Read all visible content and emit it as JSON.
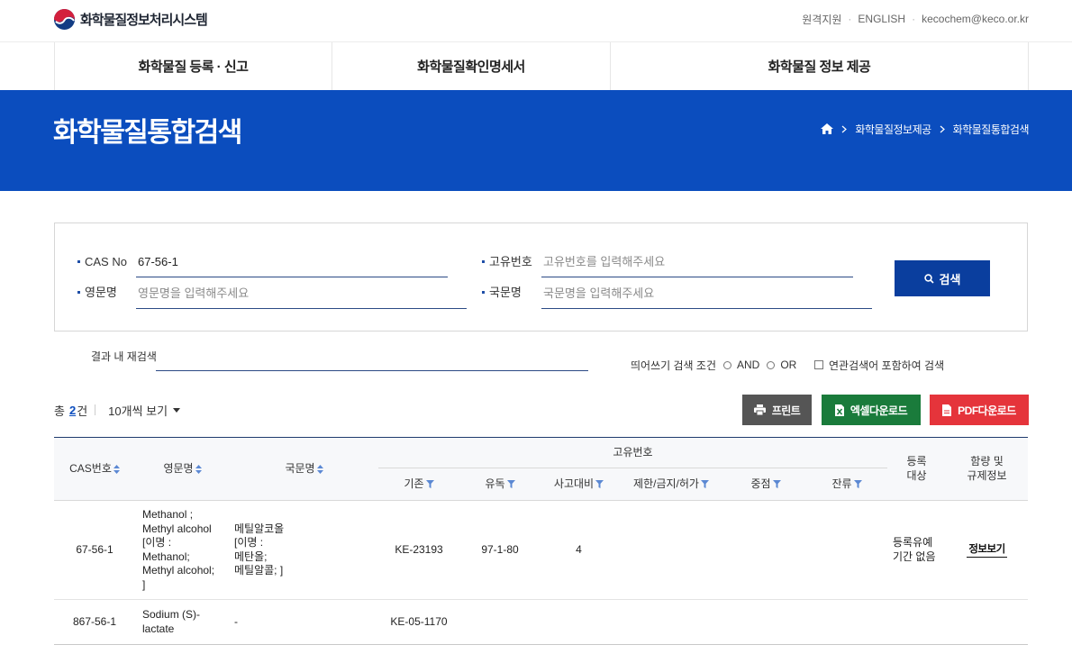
{
  "header": {
    "site_name": "화학물질정보처리시스템",
    "util_links": [
      "원격지원",
      "ENGLISH",
      "kecochem@keco.or.kr"
    ]
  },
  "nav": {
    "items": [
      "화학물질 등록 · 신고",
      "화학물질확인명세서",
      "화학물질 정보 제공"
    ]
  },
  "banner": {
    "title": "화학물질통합검색",
    "breadcrumb": [
      "화학물질정보제공",
      "화학물질통합검색"
    ]
  },
  "search": {
    "cas": {
      "label": "CAS No",
      "value": "67-56-1"
    },
    "uid": {
      "label": "고유번호",
      "placeholder": "고유번호를 입력해주세요"
    },
    "eng": {
      "label": "영문명",
      "placeholder": "영문명을 입력해주세요"
    },
    "kor": {
      "label": "국문명",
      "placeholder": "국문명을 입력해주세요"
    },
    "button_label": "검색"
  },
  "refine": {
    "label": "결과 내 재검색",
    "space_condition_label": "띄어쓰기 검색 조건",
    "options": [
      "AND",
      "OR"
    ],
    "related_label": "연관검색어 포함하여 검색"
  },
  "results": {
    "total_prefix": "총",
    "total_count": "2",
    "total_suffix": "건",
    "page_size": "10개씩 보기",
    "print_label": "프린트",
    "excel_label": "엑셀다운로드",
    "pdf_label": "PDF다운로드"
  },
  "table": {
    "headers": {
      "cas": "CAS번호",
      "eng": "영문명",
      "kor": "국문명",
      "uid_group": "고유번호",
      "existing": "기존",
      "toxic": "유독",
      "accident": "사고대비",
      "restricted": "제한/금지/허가",
      "priority": "중점",
      "residual": "잔류",
      "registration": [
        "등록",
        "대상"
      ],
      "info": [
        "함량 및",
        "규제정보"
      ]
    },
    "rows": [
      {
        "cas": "67-56-1",
        "eng_name": [
          "Methanol ;",
          "Methyl alcohol",
          "[이명 :",
          "Methanol;",
          "Methyl alcohol;",
          "]"
        ],
        "kor_name": [
          "메틸알코올",
          "[이명 :",
          "메탄올;",
          "메틸알콜; ]"
        ],
        "existing": "KE-23193",
        "toxic": "97-1-80",
        "accident": "4",
        "registration": [
          "등록유예",
          "기간 없음"
        ],
        "info_link": "정보보기"
      },
      {
        "cas": "867-56-1",
        "eng_name": [
          "Sodium (S)-",
          "lactate"
        ],
        "kor_name": [
          "-"
        ],
        "existing": "KE-05-1170"
      }
    ]
  },
  "icons": {
    "logo": "government-emblem-icon",
    "breadcrumb_home": "home-icon",
    "breadcrumb_separator": "chevron-right-icon",
    "search_button": "search-icon",
    "page_size": "caret-down-icon",
    "print": "print-icon",
    "excel": "excel-icon",
    "pdf": "pdf-icon",
    "sort": "sort-icon",
    "filter": "filter-icon"
  },
  "colors": {
    "primary": "#0b4dbe",
    "button": "#0a3e9e",
    "print": "#555555",
    "excel": "#1a7b3b",
    "pdf": "#e5343b",
    "icon": "#5b88d3"
  }
}
